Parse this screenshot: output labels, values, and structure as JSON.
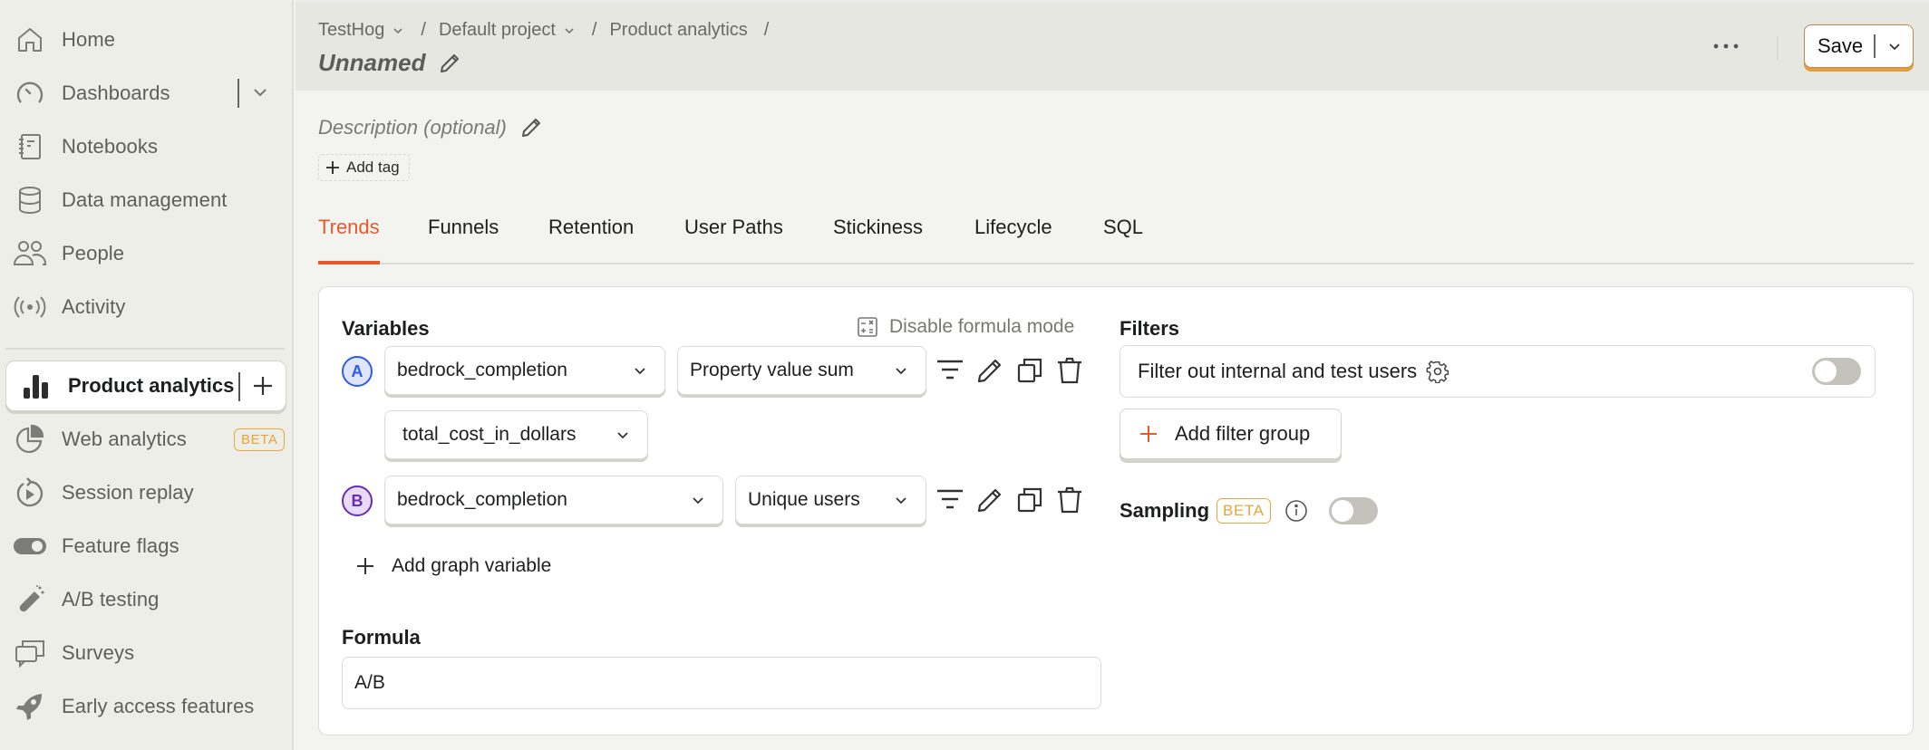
{
  "sidebar": {
    "items": [
      {
        "label": "Home",
        "icon": "home-icon"
      },
      {
        "label": "Dashboards",
        "icon": "gauge-icon"
      },
      {
        "label": "Notebooks",
        "icon": "notebook-icon"
      },
      {
        "label": "Data management",
        "icon": "database-icon"
      },
      {
        "label": "People",
        "icon": "people-icon"
      },
      {
        "label": "Activity",
        "icon": "broadcast-icon"
      }
    ],
    "active": {
      "label": "Product analytics",
      "icon": "bar-chart-icon"
    },
    "items2": [
      {
        "label": "Web analytics",
        "icon": "pie-chart-icon",
        "badge": "BETA"
      },
      {
        "label": "Session replay",
        "icon": "replay-icon"
      },
      {
        "label": "Feature flags",
        "icon": "toggle-icon"
      },
      {
        "label": "A/B testing",
        "icon": "flask-icon"
      },
      {
        "label": "Surveys",
        "icon": "chat-bubbles-icon"
      },
      {
        "label": "Early access features",
        "icon": "rocket-icon"
      }
    ]
  },
  "header": {
    "breadcrumb": [
      "TestHog",
      "Default project",
      "Product analytics"
    ],
    "title": "Unnamed",
    "save_label": "Save"
  },
  "description_placeholder": "Description (optional)",
  "add_tag_label": "Add tag",
  "tabs": [
    {
      "label": "Trends",
      "active": true
    },
    {
      "label": "Funnels"
    },
    {
      "label": "Retention"
    },
    {
      "label": "User Paths"
    },
    {
      "label": "Stickiness"
    },
    {
      "label": "Lifecycle"
    },
    {
      "label": "SQL"
    }
  ],
  "query": {
    "variables_heading": "Variables",
    "formula_mode_toggle": "Disable formula mode",
    "series": [
      {
        "letter": "A",
        "event": "bedrock_completion",
        "math": "Property value sum",
        "property": "total_cost_in_dollars"
      },
      {
        "letter": "B",
        "event": "bedrock_completion",
        "math": "Unique users"
      }
    ],
    "add_variable_label": "Add graph variable",
    "formula_heading": "Formula",
    "formula_value": "A/B"
  },
  "filters": {
    "heading": "Filters",
    "internal_filter_label": "Filter out internal and test users",
    "internal_filter_enabled": false,
    "add_filter_group_label": "Add filter group",
    "sampling_label": "Sampling",
    "sampling_badge": "BETA",
    "sampling_enabled": false
  },
  "colors": {
    "accent": "#e5592b",
    "series_a": "#2e5af0",
    "series_b": "#6b2bb5",
    "beta": "#e8a437"
  }
}
